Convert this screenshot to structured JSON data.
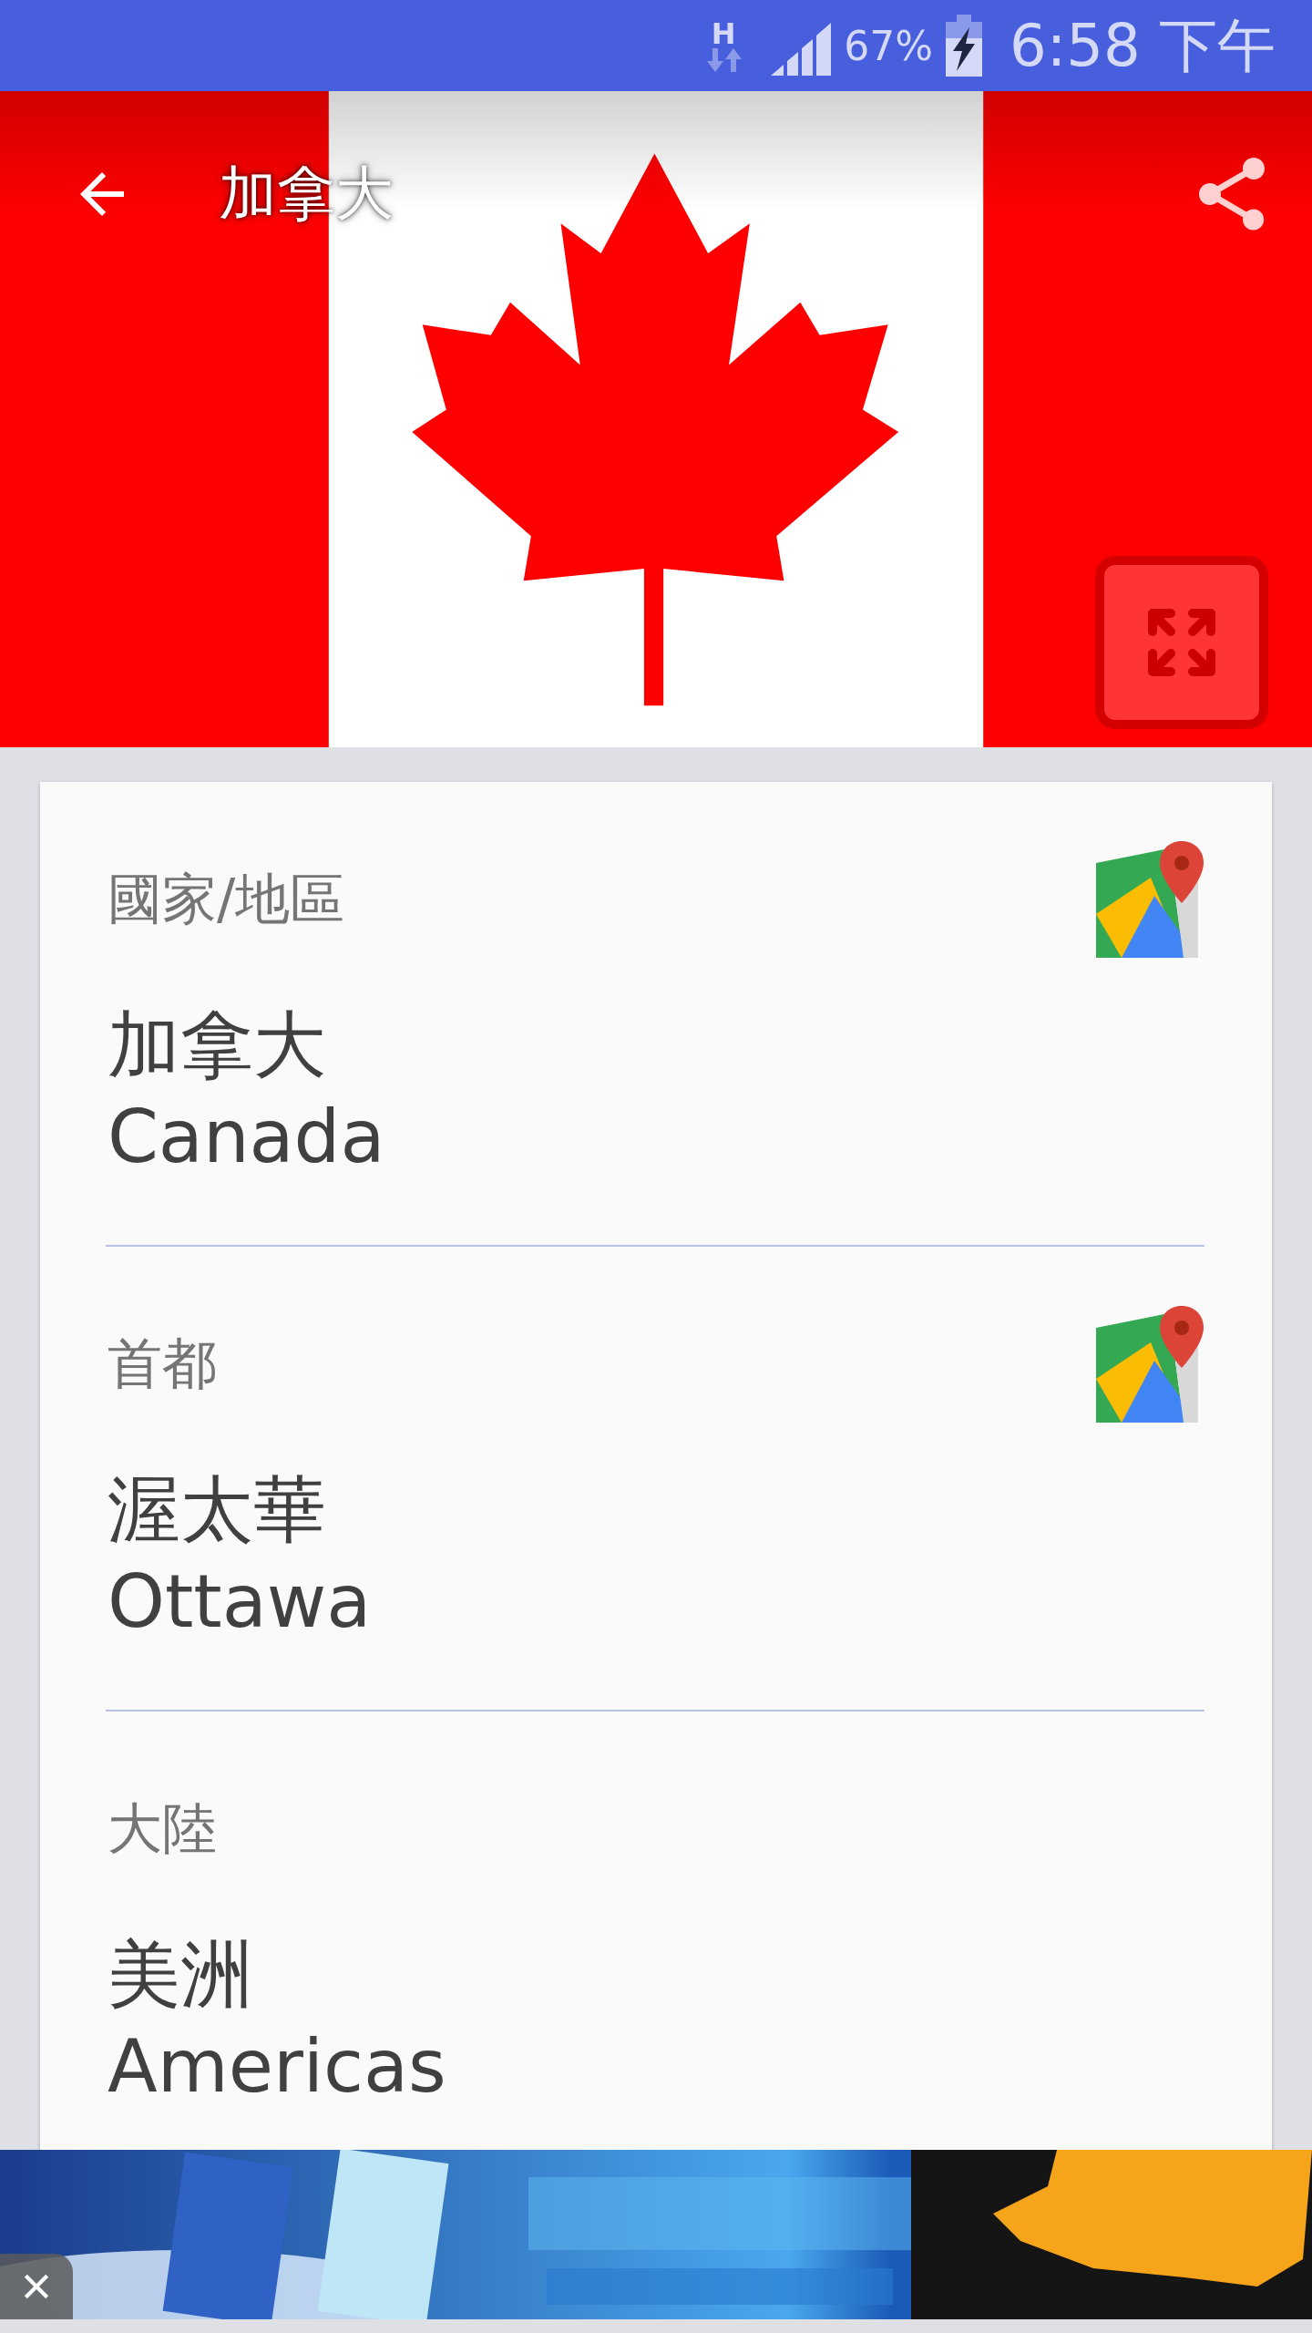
{
  "status_bar": {
    "network_type": "H",
    "battery": "67%",
    "time": "6:58 下午"
  },
  "app_bar": {
    "title": "加拿大"
  },
  "sections": [
    {
      "label": "國家/地區",
      "value_lines": [
        "加拿大",
        "Canada"
      ],
      "map_link": true
    },
    {
      "label": "首都",
      "value_lines": [
        "渥太華",
        "Ottawa"
      ],
      "map_link": true
    },
    {
      "label": "大陸",
      "value_lines": [
        "美洲",
        "Americas"
      ],
      "map_link": false
    }
  ]
}
